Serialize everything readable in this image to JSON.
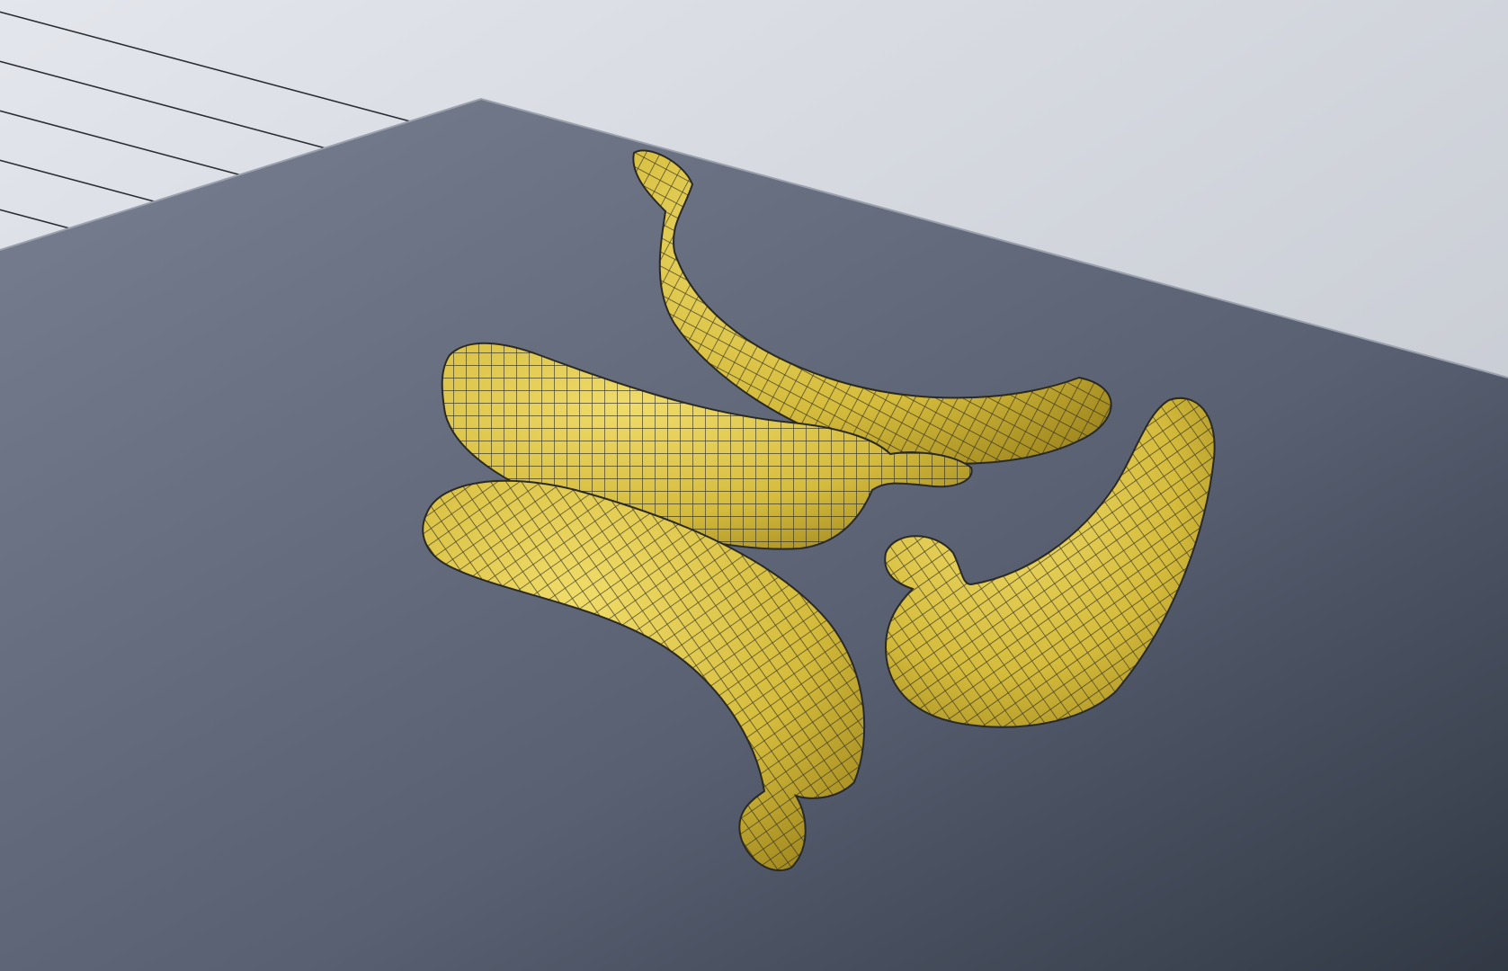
{
  "scene": {
    "view": "3d-viewport-wireframe-shaded",
    "subject": "bananas",
    "object_count": 4,
    "colors": {
      "backdrop_light": "#dcdfe6",
      "backdrop_mid": "#c4c8d0",
      "backdrop_line": "#2a2d33",
      "table_top_light": "#6e7688",
      "table_top_dark": "#353c48",
      "banana_light": "#e6d25c",
      "banana_dark": "#a88e1e",
      "mesh_line": "#2b2a22"
    }
  }
}
